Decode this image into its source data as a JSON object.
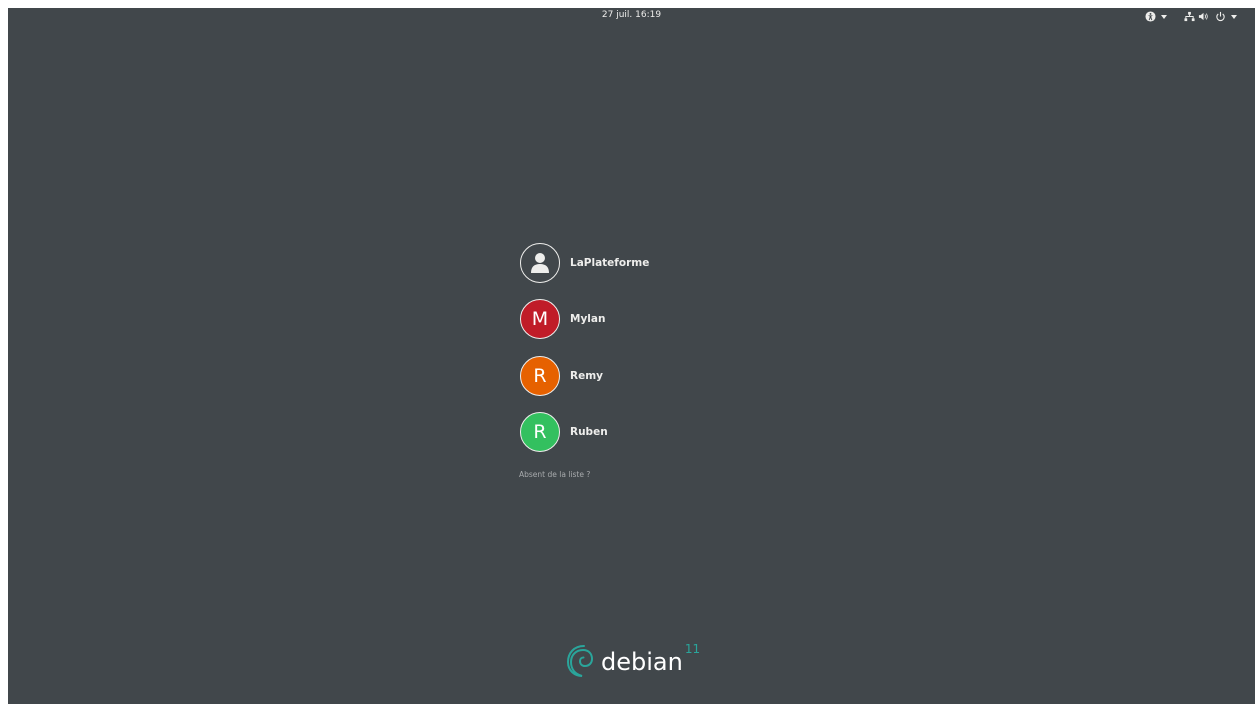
{
  "topbar": {
    "clock": "27 juil.  16:19",
    "icons": {
      "accessibility": "accessibility-icon",
      "network": "network-wired-icon",
      "volume": "volume-icon",
      "power": "power-icon"
    }
  },
  "users": [
    {
      "name": "LaPlateforme",
      "initial": "",
      "color": "#41474b",
      "avatar": "default-user-icon"
    },
    {
      "name": "Mylan",
      "initial": "M",
      "color": "#c01c28"
    },
    {
      "name": "Remy",
      "initial": "R",
      "color": "#e66100"
    },
    {
      "name": "Ruben",
      "initial": "R",
      "color": "#33c05f"
    }
  ],
  "not_listed_label": "Absent de la liste ?",
  "logo": {
    "word": "debian",
    "version": "11",
    "accent_color": "#2aa59b",
    "dot_color": "#d70a53"
  }
}
